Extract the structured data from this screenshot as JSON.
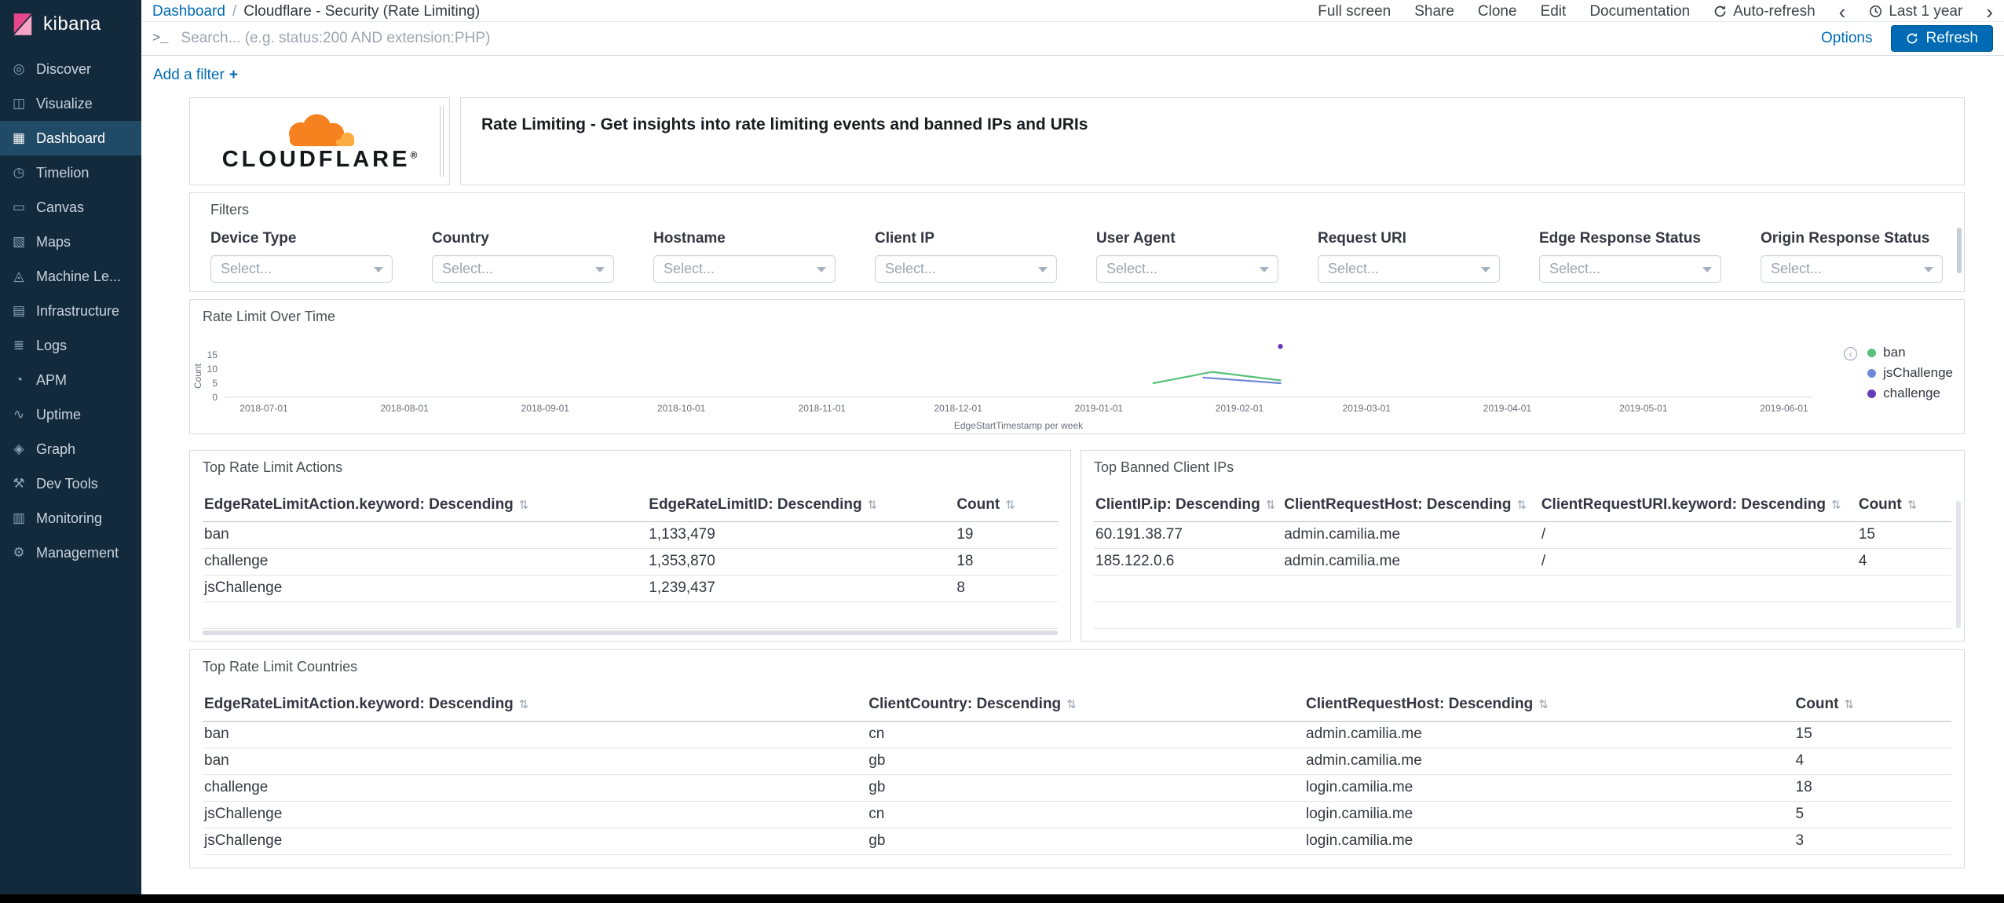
{
  "sidebar": {
    "logo_text": "kibana",
    "items": [
      {
        "label": "Discover",
        "icon": "◎"
      },
      {
        "label": "Visualize",
        "icon": "◫"
      },
      {
        "label": "Dashboard",
        "icon": "▦"
      },
      {
        "label": "Timelion",
        "icon": "◷"
      },
      {
        "label": "Canvas",
        "icon": "▭"
      },
      {
        "label": "Maps",
        "icon": "▧"
      },
      {
        "label": "Machine Le...",
        "icon": "◬"
      },
      {
        "label": "Infrastructure",
        "icon": "▤"
      },
      {
        "label": "Logs",
        "icon": "≣"
      },
      {
        "label": "APM",
        "icon": "◔"
      },
      {
        "label": "Uptime",
        "icon": "∿"
      },
      {
        "label": "Graph",
        "icon": "◈"
      },
      {
        "label": "Dev Tools",
        "icon": "⚒"
      },
      {
        "label": "Monitoring",
        "icon": "▥"
      },
      {
        "label": "Management",
        "icon": "⚙"
      }
    ]
  },
  "topbar": {
    "breadcrumb": {
      "root": "Dashboard",
      "separator": "/",
      "current": "Cloudflare - Security (Rate Limiting)"
    },
    "menu": {
      "full_screen": "Full screen",
      "share": "Share",
      "clone": "Clone",
      "edit": "Edit",
      "documentation": "Documentation",
      "auto_refresh": "Auto-refresh",
      "time_back": "‹",
      "time_range": "Last 1 year",
      "time_forward": "›"
    }
  },
  "searchbar": {
    "prompt": ">_",
    "placeholder": "Search... (e.g. status:200 AND extension:PHP)",
    "options": "Options",
    "refresh": "Refresh"
  },
  "filter_bar": {
    "add_filter": "Add a filter",
    "plus": "+"
  },
  "logo_panel": {
    "brand": "CLOUDFLARE",
    "registered": "®"
  },
  "markdown_panel": {
    "text": "Rate Limiting - Get insights into rate limiting events and banned IPs and URIs"
  },
  "filters": {
    "title": "Filters",
    "fields": [
      {
        "label": "Device Type",
        "placeholder": "Select..."
      },
      {
        "label": "Country",
        "placeholder": "Select..."
      },
      {
        "label": "Hostname",
        "placeholder": "Select..."
      },
      {
        "label": "Client IP",
        "placeholder": "Select..."
      },
      {
        "label": "User Agent",
        "placeholder": "Select..."
      },
      {
        "label": "Request URI",
        "placeholder": "Select..."
      },
      {
        "label": "Edge Response Status",
        "placeholder": "Select..."
      },
      {
        "label": "Origin Response Status",
        "placeholder": "Select..."
      }
    ]
  },
  "chart_data": {
    "type": "line",
    "title": "Rate Limit Over Time",
    "xlabel": "EdgeStartTimestamp per week",
    "ylabel": "Count",
    "ylim": [
      0,
      15
    ],
    "yticks": [
      0,
      5,
      10,
      15
    ],
    "xticks": [
      "2018-07-01",
      "2018-08-01",
      "2018-09-01",
      "2018-10-01",
      "2018-11-01",
      "2018-12-01",
      "2019-01-01",
      "2019-02-01",
      "2019-03-01",
      "2019-04-01",
      "2019-05-01",
      "2019-06-01"
    ],
    "legend_position": "right",
    "grid": false,
    "series": [
      {
        "name": "ban",
        "color": "#57c17b",
        "points": [
          [
            "2019-01-13",
            5
          ],
          [
            "2019-01-26",
            9
          ],
          [
            "2019-02-10",
            6
          ]
        ]
      },
      {
        "name": "jsChallenge",
        "color": "#6f87d8",
        "points": [
          [
            "2019-01-24",
            7
          ],
          [
            "2019-02-10",
            5
          ]
        ]
      },
      {
        "name": "challenge",
        "color": "#663db8",
        "points": [
          [
            "2019-02-10",
            18
          ]
        ]
      }
    ]
  },
  "tables": {
    "actions": {
      "title": "Top Rate Limit Actions",
      "columns": [
        "EdgeRateLimitAction.keyword: Descending",
        "EdgeRateLimitID: Descending",
        "Count"
      ],
      "rows": [
        [
          "ban",
          "1,133,479",
          "19"
        ],
        [
          "challenge",
          "1,353,870",
          "18"
        ],
        [
          "jsChallenge",
          "1,239,437",
          "8"
        ]
      ]
    },
    "banned_ips": {
      "title": "Top Banned Client IPs",
      "columns": [
        "ClientIP.ip: Descending",
        "ClientRequestHost: Descending",
        "ClientRequestURI.keyword: Descending",
        "Count"
      ],
      "rows": [
        [
          "60.191.38.77",
          "admin.camilia.me",
          "/",
          "15"
        ],
        [
          "185.122.0.6",
          "admin.camilia.me",
          "/",
          "4"
        ]
      ]
    },
    "countries": {
      "title": "Top Rate Limit Countries",
      "columns": [
        "EdgeRateLimitAction.keyword: Descending",
        "ClientCountry: Descending",
        "ClientRequestHost: Descending",
        "Count"
      ],
      "rows": [
        [
          "ban",
          "cn",
          "admin.camilia.me",
          "15"
        ],
        [
          "ban",
          "gb",
          "admin.camilia.me",
          "4"
        ],
        [
          "challenge",
          "gb",
          "login.camilia.me",
          "18"
        ],
        [
          "jsChallenge",
          "cn",
          "login.camilia.me",
          "5"
        ],
        [
          "jsChallenge",
          "gb",
          "login.camilia.me",
          "3"
        ]
      ]
    }
  },
  "icons": {
    "sort": "⇅",
    "legend_toggle": "‹"
  },
  "colors": {
    "accent_link": "#006BB4",
    "refresh_button": "#006BB4",
    "sidebar_bg": "#13293c"
  }
}
